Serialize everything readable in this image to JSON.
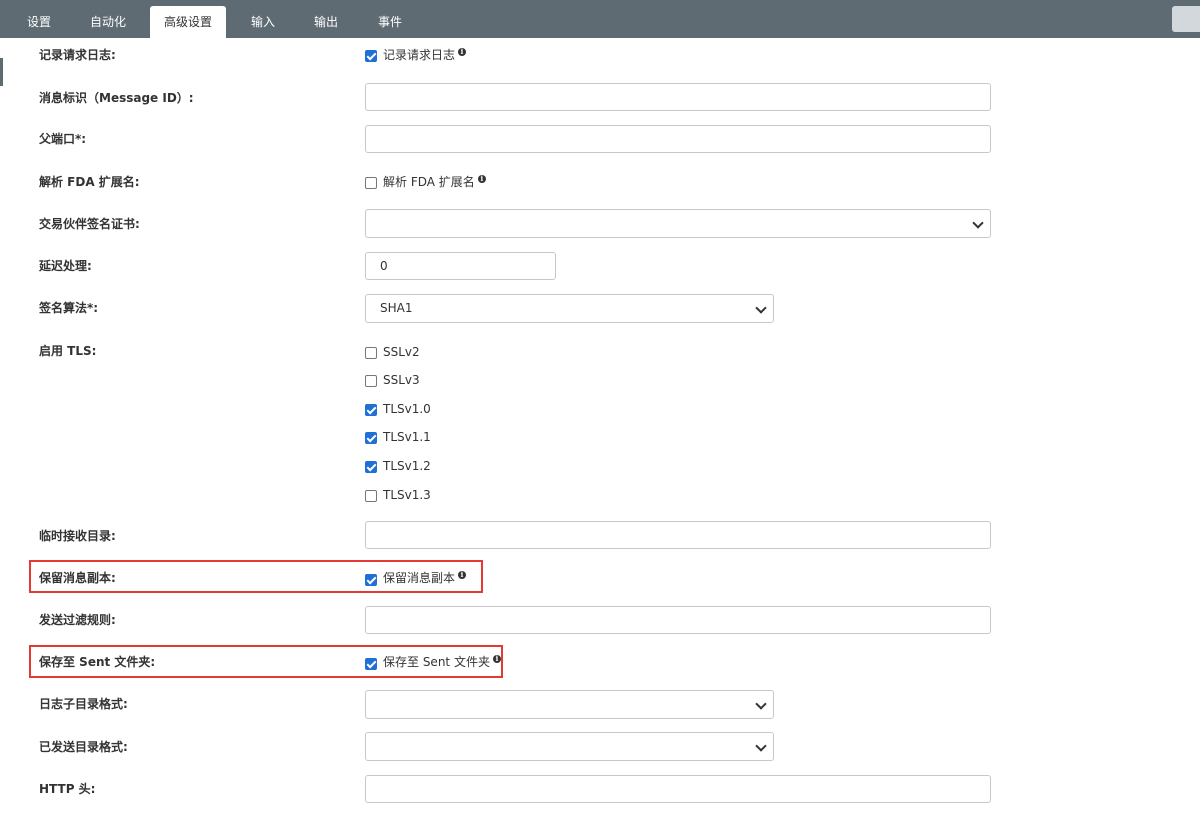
{
  "tabs": [
    {
      "label": "设置"
    },
    {
      "label": "自动化"
    },
    {
      "label": "高级设置",
      "active": true
    },
    {
      "label": "输入"
    },
    {
      "label": "输出"
    },
    {
      "label": "事件"
    }
  ],
  "form": {
    "log_request": {
      "label": "记录请求日志:",
      "checkbox_label": "记录请求日志",
      "checked": true
    },
    "message_id": {
      "label": "消息标识（Message ID）:",
      "value": ""
    },
    "parent_port": {
      "label": "父端口*:",
      "value": ""
    },
    "parse_fda": {
      "label": "解析 FDA 扩展名:",
      "checkbox_label": "解析 FDA 扩展名",
      "checked": false
    },
    "partner_cert": {
      "label": "交易伙伴签名证书:",
      "value": ""
    },
    "delay": {
      "label": "延迟处理:",
      "value": "0"
    },
    "sign_alg": {
      "label": "签名算法*:",
      "value": "SHA1"
    },
    "tls": {
      "label": "启用 TLS:",
      "options": [
        {
          "name": "SSLv2",
          "checked": false
        },
        {
          "name": "SSLv3",
          "checked": false
        },
        {
          "name": "TLSv1.0",
          "checked": true
        },
        {
          "name": "TLSv1.1",
          "checked": true
        },
        {
          "name": "TLSv1.2",
          "checked": true
        },
        {
          "name": "TLSv1.3",
          "checked": false
        }
      ]
    },
    "temp_dir": {
      "label": "临时接收目录:",
      "value": ""
    },
    "keep_copy": {
      "label": "保留消息副本:",
      "checkbox_label": "保留消息副本",
      "checked": true
    },
    "send_filter": {
      "label": "发送过滤规则:",
      "value": ""
    },
    "save_sent": {
      "label": "保存至 Sent 文件夹:",
      "checkbox_label": "保存至 Sent 文件夹",
      "checked": true
    },
    "log_subdir": {
      "label": "日志子目录格式:",
      "value": ""
    },
    "sent_dir": {
      "label": "已发送目录格式:",
      "value": ""
    },
    "http_header": {
      "label": "HTTP 头:",
      "value": ""
    }
  },
  "colors": {
    "topbar": "#5f6b73",
    "checkbox": "#1f6fd6",
    "highlight": "#e53935"
  },
  "icons": {
    "info": "info-circle-icon",
    "select_arrow": "chevron-down-icon"
  }
}
